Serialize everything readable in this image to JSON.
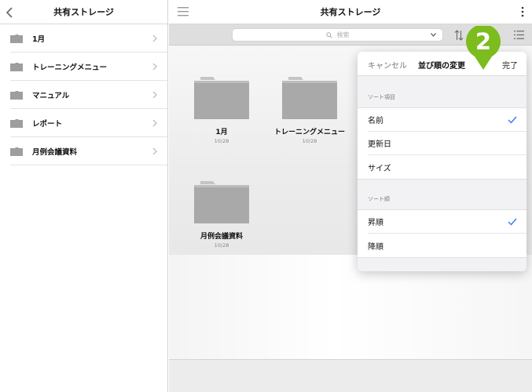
{
  "sidebar": {
    "title": "共有ストレージ",
    "items": [
      {
        "label": "1月"
      },
      {
        "label": "トレーニングメニュー"
      },
      {
        "label": "マニュアル"
      },
      {
        "label": "レポート"
      },
      {
        "label": "月例会議資料"
      }
    ]
  },
  "main": {
    "title": "共有ストレージ",
    "search": {
      "placeholder": "検索"
    },
    "folders": [
      {
        "name": "1月",
        "date": "10/28"
      },
      {
        "name": "トレーニングメニュー",
        "date": "10/28"
      },
      {
        "name": "月例会議資料",
        "date": "10/28"
      }
    ]
  },
  "sort_popover": {
    "cancel_label": "キャンセル",
    "title": "並び順の変更",
    "done_label": "完了",
    "sort_item_header": "ソート項目",
    "sort_items": [
      {
        "label": "名前",
        "selected": true
      },
      {
        "label": "更新日",
        "selected": false
      },
      {
        "label": "サイズ",
        "selected": false
      }
    ],
    "sort_order_header": "ソート順",
    "sort_orders": [
      {
        "label": "昇順",
        "selected": true
      },
      {
        "label": "降順",
        "selected": false
      }
    ]
  },
  "step_marker": {
    "number": "2",
    "color": "#7cbc1e"
  },
  "colors": {
    "accent": "#3478f6",
    "folder": "#a9a9a9",
    "folder_tab": "#c4c4c4"
  }
}
